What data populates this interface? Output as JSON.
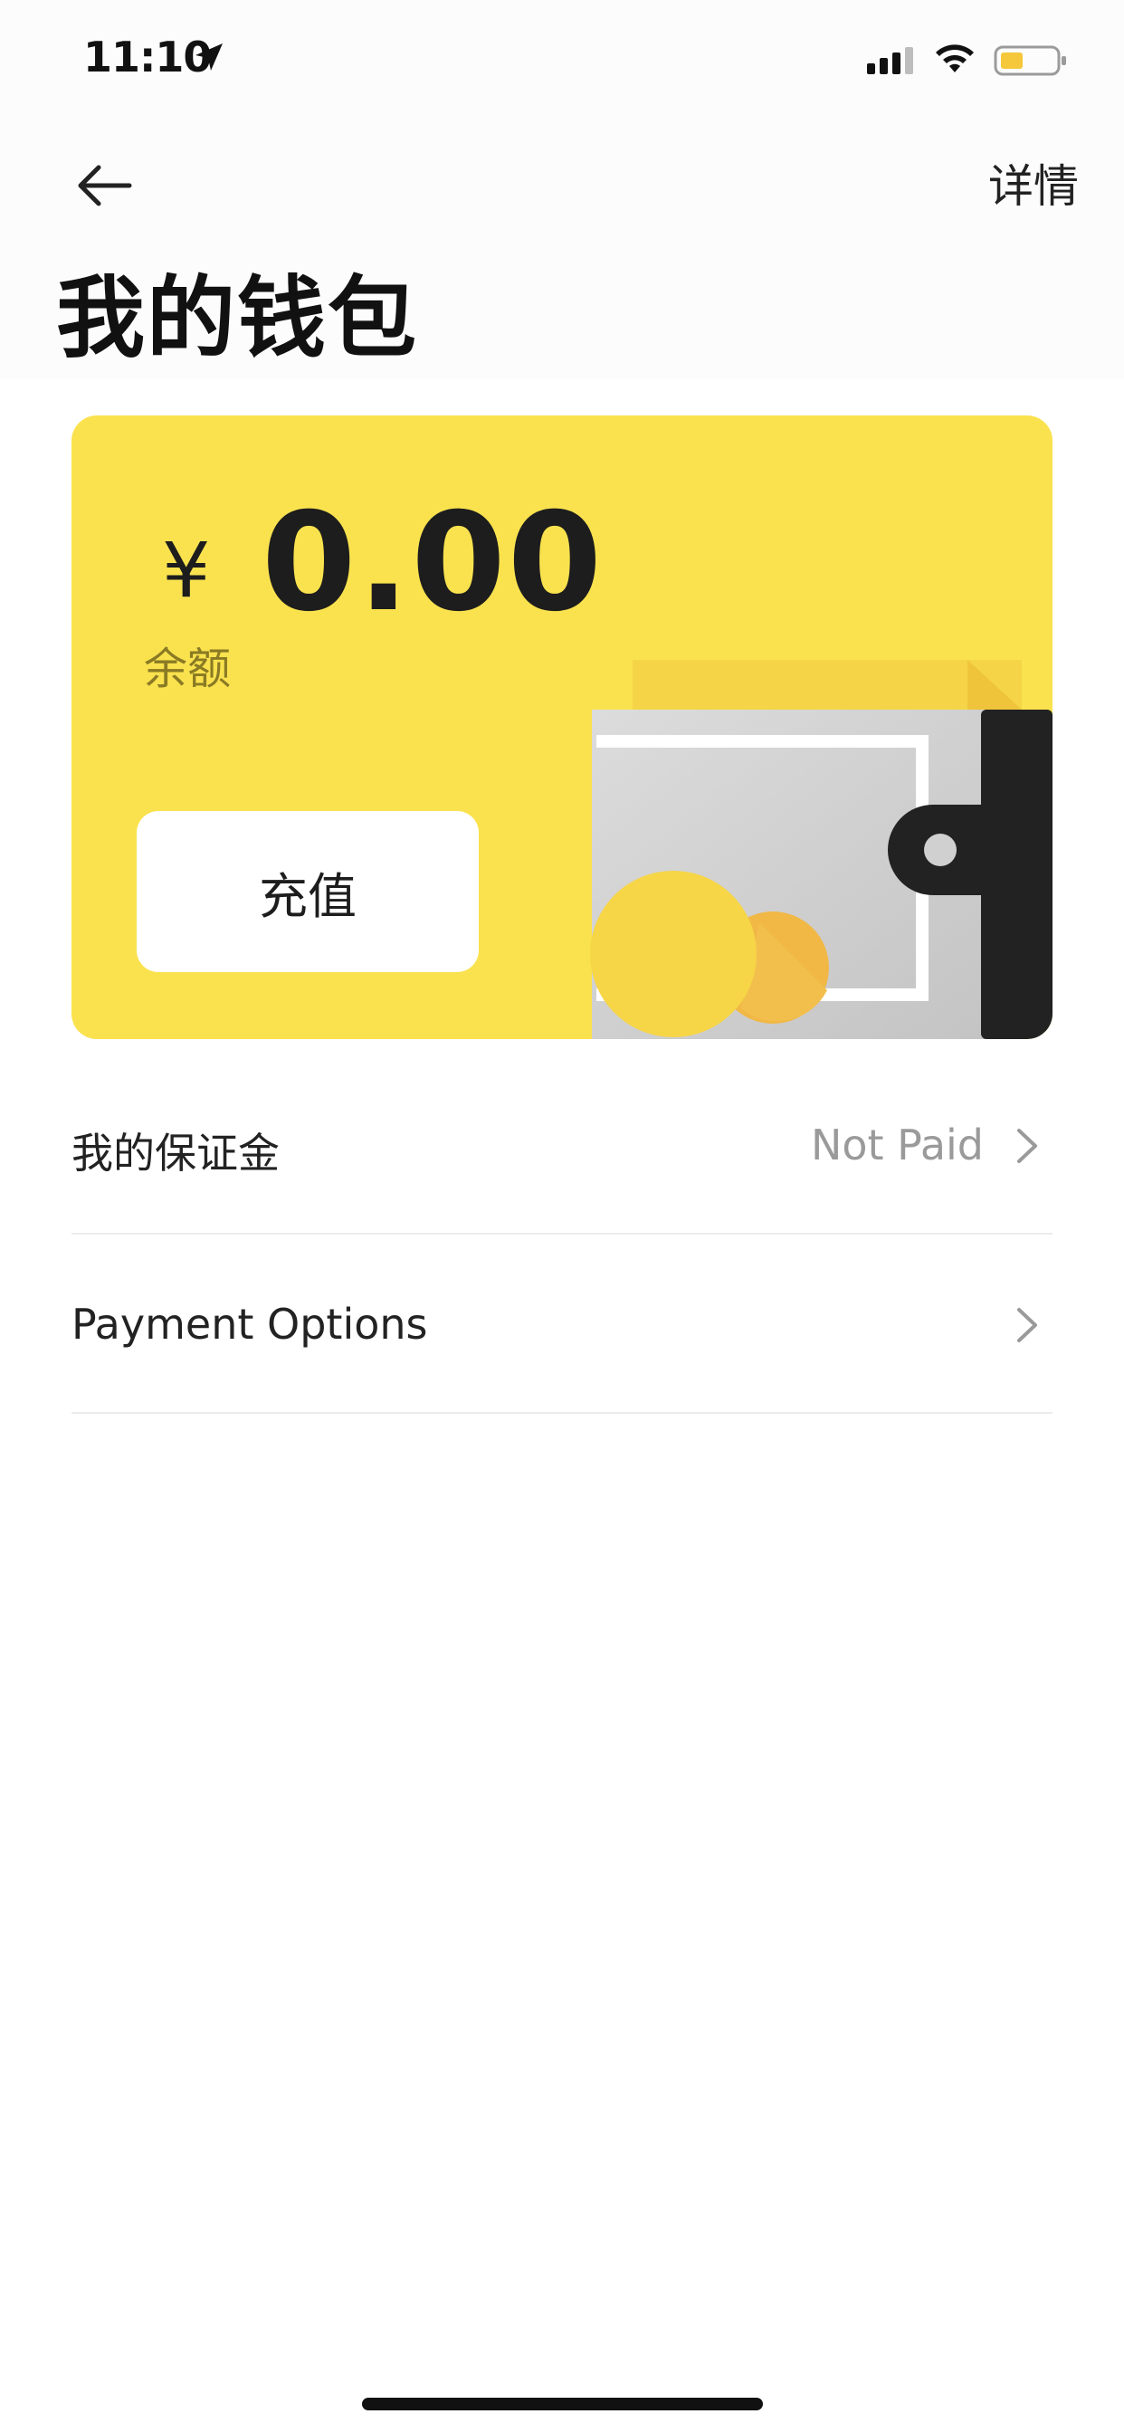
{
  "status_bar": {
    "time": "11:10",
    "icons": [
      "location-arrow-icon",
      "signal-icon",
      "wifi-icon",
      "battery-icon"
    ],
    "battery_color": "#f5c73a"
  },
  "header": {
    "back_icon": "arrow-left-icon",
    "details_label": "详情",
    "title": "我的钱包"
  },
  "wallet": {
    "currency_symbol": "¥",
    "balance": "0.00",
    "balance_label": "余额",
    "recharge_label": "充值",
    "card_color": "#f9e24e",
    "illustration": "wallet-with-coins-icon"
  },
  "list": [
    {
      "label": "我的保证金",
      "value": "Not Paid",
      "icon": "chevron-right-icon"
    },
    {
      "label": "Payment Options",
      "value": "",
      "icon": "chevron-right-icon"
    }
  ]
}
